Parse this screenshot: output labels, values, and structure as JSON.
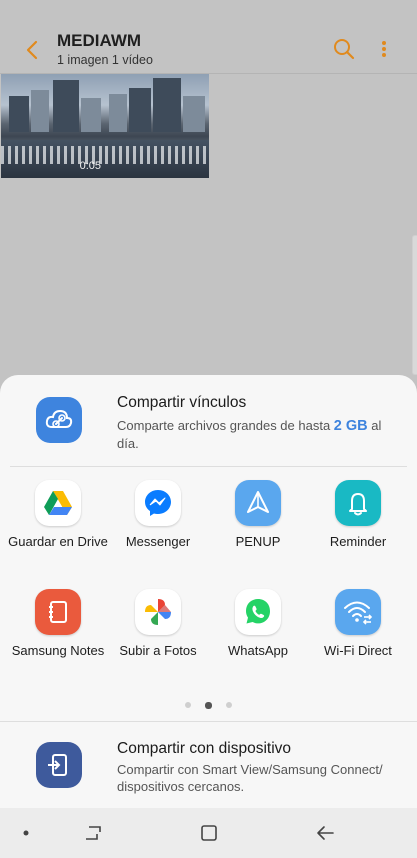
{
  "appbar": {
    "title": "MEDIAWM",
    "subtitle": "1 imagen  1 vídeo",
    "accent": "#e08a1e",
    "icons": [
      "back-arrow-icon",
      "search-icon",
      "more-vert-icon"
    ]
  },
  "thumbnails": [
    {
      "type": "video",
      "duration": "0:05"
    },
    {
      "type": "image"
    }
  ],
  "link_share": {
    "title": "Compartir vínculos",
    "desc_before": "Comparte archivos grandes de hasta ",
    "size": "2 GB",
    "desc_after": " al día.",
    "icon": "cloud-link-icon",
    "color": "#3e84de"
  },
  "apps": [
    {
      "label": "Guardar en Drive",
      "icon": "google-drive-icon"
    },
    {
      "label": "Messenger",
      "icon": "messenger-icon"
    },
    {
      "label": "PENUP",
      "icon": "penup-icon"
    },
    {
      "label": "Reminder",
      "icon": "reminder-bell-icon"
    },
    {
      "label": "Samsung Notes",
      "icon": "samsung-notes-icon"
    },
    {
      "label": "Subir a Fotos",
      "icon": "google-photos-icon"
    },
    {
      "label": "WhatsApp",
      "icon": "whatsapp-icon"
    },
    {
      "label": "Wi-Fi Direct",
      "icon": "wifi-direct-icon"
    }
  ],
  "pager": {
    "pages": 3,
    "active": 2
  },
  "device_share": {
    "title": "Compartir con dispositivo",
    "desc": "Compartir con Smart View/Samsung Connect/ dispositivos cercanos.",
    "icon": "device-share-icon",
    "color": "#3e5a9c"
  },
  "navbar": {
    "icons": [
      "dot-indicator-icon",
      "recent-apps-icon",
      "home-icon",
      "back-icon"
    ]
  }
}
